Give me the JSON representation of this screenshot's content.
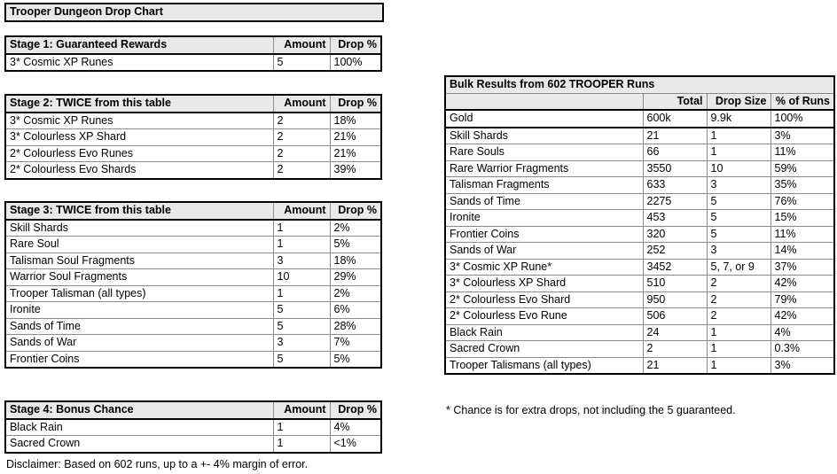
{
  "chart_title": "Trooper Dungeon Drop Chart",
  "left_tables": [
    {
      "name": "stage1",
      "header": {
        "label": "Stage 1: Guaranteed Rewards",
        "amount": "Amount",
        "drop": "Drop %"
      },
      "rows": [
        {
          "item": "3* Cosmic XP Runes",
          "amount": "5",
          "drop": "100%"
        }
      ]
    },
    {
      "name": "stage2",
      "header": {
        "label": "Stage 2: TWICE from this table",
        "amount": "Amount",
        "drop": "Drop %"
      },
      "rows": [
        {
          "item": "3* Cosmic XP Runes",
          "amount": "2",
          "drop": "18%"
        },
        {
          "item": "3* Colourless XP Shard",
          "amount": "2",
          "drop": "21%"
        },
        {
          "item": "2* Colourless Evo Runes",
          "amount": "2",
          "drop": "21%"
        },
        {
          "item": "2* Colourless Evo Shards",
          "amount": "2",
          "drop": "39%"
        }
      ]
    },
    {
      "name": "stage3",
      "header": {
        "label": "Stage 3: TWICE from this table",
        "amount": "Amount",
        "drop": "Drop %"
      },
      "rows": [
        {
          "item": "Skill Shards",
          "amount": "1",
          "drop": "2%"
        },
        {
          "item": "Rare Soul",
          "amount": "1",
          "drop": "5%"
        },
        {
          "item": "Talisman Soul Fragments",
          "amount": "3",
          "drop": "18%"
        },
        {
          "item": "Warrior Soul Fragments",
          "amount": "10",
          "drop": "29%"
        },
        {
          "item": "Trooper Talisman (all types)",
          "amount": "1",
          "drop": "2%"
        },
        {
          "item": "Ironite",
          "amount": "5",
          "drop": "6%"
        },
        {
          "item": "Sands of Time",
          "amount": "5",
          "drop": "28%"
        },
        {
          "item": "Sands of War",
          "amount": "3",
          "drop": "7%"
        },
        {
          "item": "Frontier Coins",
          "amount": "5",
          "drop": "5%"
        }
      ]
    },
    {
      "name": "stage4",
      "header": {
        "label": "Stage 4: Bonus Chance",
        "amount": "Amount",
        "drop": "Drop %"
      },
      "rows": [
        {
          "item": "Black Rain",
          "amount": "1",
          "drop": "4%"
        },
        {
          "item": "Sacred Crown",
          "amount": "1",
          "drop": "<1%"
        }
      ]
    }
  ],
  "disclaimer": "Disclaimer: Based on 602 runs, up to a +- 4% margin of error.",
  "bulk": {
    "title": "Bulk Results from 602 TROOPER Runs",
    "header": {
      "blank": "",
      "total": "Total",
      "drop_size": "Drop Size",
      "pct_runs": "% of Runs"
    },
    "rows": [
      {
        "item": "Gold",
        "total": "600k",
        "size": "9.9k",
        "pct": "100%"
      },
      {
        "item": "Skill Shards",
        "total": "21",
        "size": "1",
        "pct": "3%"
      },
      {
        "item": "Rare Souls",
        "total": "66",
        "size": "1",
        "pct": "11%"
      },
      {
        "item": "Rare Warrior Fragments",
        "total": "3550",
        "size": "10",
        "pct": "59%"
      },
      {
        "item": "Talisman Fragments",
        "total": "633",
        "size": "3",
        "pct": "35%"
      },
      {
        "item": "Sands of Time",
        "total": "2275",
        "size": "5",
        "pct": "76%"
      },
      {
        "item": "Ironite",
        "total": "453",
        "size": "5",
        "pct": "15%"
      },
      {
        "item": "Frontier Coins",
        "total": "320",
        "size": "5",
        "pct": "11%"
      },
      {
        "item": "Sands of War",
        "total": "252",
        "size": "3",
        "pct": "14%"
      },
      {
        "item": "3* Cosmic XP Rune*",
        "total": "3452",
        "size": "5, 7, or 9",
        "pct": "37%"
      },
      {
        "item": "3* Colourless XP Shard",
        "total": "510",
        "size": "2",
        "pct": "42%"
      },
      {
        "item": "2* Colourless Evo Shard",
        "total": "950",
        "size": "2",
        "pct": "79%"
      },
      {
        "item": "2* Colourless Evo Rune",
        "total": "506",
        "size": "2",
        "pct": "42%"
      },
      {
        "item": "Black Rain",
        "total": "24",
        "size": "1",
        "pct": "4%"
      },
      {
        "item": "Sacred Crown",
        "total": "2",
        "size": "1",
        "pct": "0.3%"
      },
      {
        "item": "Trooper Talismans (all types)",
        "total": "21",
        "size": "1",
        "pct": "3%"
      }
    ],
    "footnote": "* Chance is for extra drops, not including the 5 guaranteed."
  },
  "colors": {
    "header_bg": "#e9e9e9",
    "grid_line": "#8a8a8a",
    "frame": "#000000",
    "text": "#000000",
    "page_bg": "#ffffff"
  }
}
